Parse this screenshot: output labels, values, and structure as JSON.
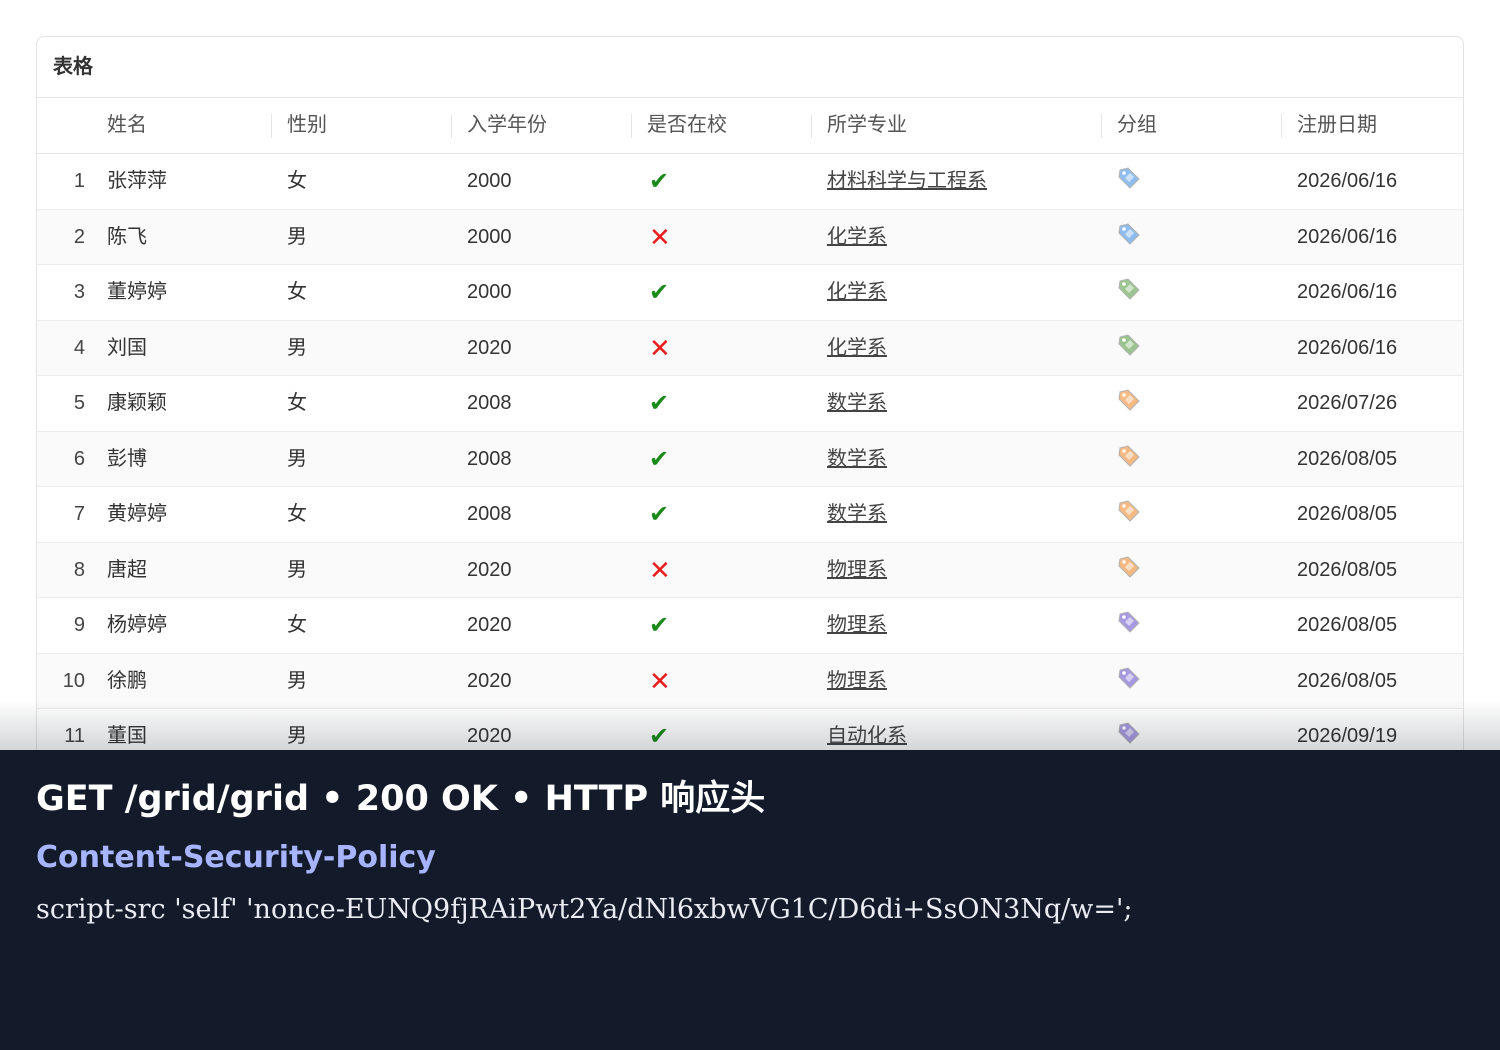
{
  "panel": {
    "title": "表格"
  },
  "table": {
    "headers": [
      "姓名",
      "性别",
      "入学年份",
      "是否在校",
      "所学专业",
      "分组",
      "注册日期"
    ],
    "rows": [
      {
        "index": "1",
        "name": "张萍萍",
        "gender": "女",
        "year": "2000",
        "enrolled": true,
        "major": "材料科学与工程系",
        "group_color": "#6aa8e8",
        "date": "2026/06/16"
      },
      {
        "index": "2",
        "name": "陈飞",
        "gender": "男",
        "year": "2000",
        "enrolled": false,
        "major": "化学系",
        "group_color": "#6aa8e8",
        "date": "2026/06/16"
      },
      {
        "index": "3",
        "name": "董婷婷",
        "gender": "女",
        "year": "2000",
        "enrolled": true,
        "major": "化学系",
        "group_color": "#7bb36a",
        "date": "2026/06/16"
      },
      {
        "index": "4",
        "name": "刘国",
        "gender": "男",
        "year": "2020",
        "enrolled": false,
        "major": "化学系",
        "group_color": "#7bb36a",
        "date": "2026/06/16"
      },
      {
        "index": "5",
        "name": "康颖颖",
        "gender": "女",
        "year": "2008",
        "enrolled": true,
        "major": "数学系",
        "group_color": "#f3a45c",
        "date": "2026/07/26"
      },
      {
        "index": "6",
        "name": "彭博",
        "gender": "男",
        "year": "2008",
        "enrolled": true,
        "major": "数学系",
        "group_color": "#f3a45c",
        "date": "2026/08/05"
      },
      {
        "index": "7",
        "name": "黄婷婷",
        "gender": "女",
        "year": "2008",
        "enrolled": true,
        "major": "数学系",
        "group_color": "#f3a45c",
        "date": "2026/08/05"
      },
      {
        "index": "8",
        "name": "唐超",
        "gender": "男",
        "year": "2020",
        "enrolled": false,
        "major": "物理系",
        "group_color": "#f3a45c",
        "date": "2026/08/05"
      },
      {
        "index": "9",
        "name": "杨婷婷",
        "gender": "女",
        "year": "2020",
        "enrolled": true,
        "major": "物理系",
        "group_color": "#8a78d6",
        "date": "2026/08/05"
      },
      {
        "index": "10",
        "name": "徐鹏",
        "gender": "男",
        "year": "2020",
        "enrolled": false,
        "major": "物理系",
        "group_color": "#8a78d6",
        "date": "2026/08/05"
      },
      {
        "index": "11",
        "name": "董国",
        "gender": "男",
        "year": "2020",
        "enrolled": true,
        "major": "自动化系",
        "group_color": "#8a78d6",
        "date": "2026/09/19"
      }
    ],
    "enrolled_icons": {
      "true": "✔",
      "false": "✕"
    }
  },
  "overlay": {
    "title": "GET /grid/grid • 200 OK • HTTP 响应头",
    "header_name": "Content-Security-Policy",
    "header_value": "script-src 'self' 'nonce-EUNQ9fjRAiPwt2Ya/dNl6xbwVG1C/D6di+SsON3Nq/w=';"
  },
  "colors": {
    "check": "#1a8a1a",
    "cross": "#e81d1d",
    "overlay_bg": "#131a2a",
    "overlay_label": "#a7b4ff"
  }
}
